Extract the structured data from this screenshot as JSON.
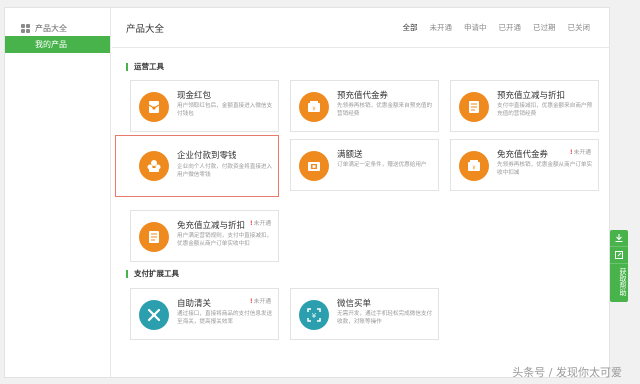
{
  "sidebar": {
    "title": "产品大全",
    "items": [
      {
        "label": "我的产品"
      }
    ]
  },
  "header": {
    "title": "产品大全",
    "tabs": [
      {
        "label": "全部",
        "active": true
      },
      {
        "label": "未开通"
      },
      {
        "label": "申请中"
      },
      {
        "label": "已开通"
      },
      {
        "label": "已过期"
      },
      {
        "label": "已关闭"
      }
    ]
  },
  "sections": {
    "ops": {
      "title": "运营工具"
    },
    "pay": {
      "title": "支付扩展工具"
    }
  },
  "cards": [
    {
      "title": "现金红包",
      "desc": "用户领取红包后，金额直接进入微信支付钱包",
      "icon": "red-packet-icon",
      "color": "#ef8a1f"
    },
    {
      "title": "预充值代金券",
      "desc": "先领券再核销，优惠金额来自预充值的营销经费",
      "icon": "voucher-icon",
      "color": "#ef8a1f"
    },
    {
      "title": "预充值立减与折扣",
      "desc": "支付中直接减扣，优惠金额来自商户预充值的营销经费",
      "icon": "discount-icon",
      "color": "#ef8a1f"
    },
    {
      "title": "企业付款到零钱",
      "desc": "企业向个人付款，付款资金将直接进入用户微信零钱",
      "icon": "enterprise-pay-icon",
      "color": "#ef8a1f"
    },
    {
      "title": "满额送",
      "desc": "订单满足一定条件，赠送优惠给用户",
      "icon": "gift-icon",
      "color": "#ef8a1f"
    },
    {
      "title": "免充值代金券",
      "badge": "未开通",
      "desc": "先领券再核销，优惠金额从商户订单实收中扣减",
      "icon": "voucher-icon",
      "color": "#ef8a1f"
    },
    {
      "title": "免充值立减与折扣",
      "badge": "未开通",
      "desc": "用户满足营销规则，支付中直接减扣，优惠金额从商户订单实收中扣",
      "icon": "discount-icon",
      "color": "#ef8a1f"
    },
    {
      "title": "自助清关",
      "badge": "未开通",
      "desc": "通过接口，直接将商品的支付信息发送至海关，提高报关效率",
      "icon": "customs-icon",
      "color": "#2b9fae"
    },
    {
      "title": "微信买单",
      "desc": "无需开发，通过手机轻松完成微信支付收款，对账等操作",
      "icon": "wechat-bill-icon",
      "color": "#2b9fae"
    }
  ],
  "help_bar": {
    "label": "获取帮助"
  },
  "watermark": "头条号 / 发现你太可爱"
}
